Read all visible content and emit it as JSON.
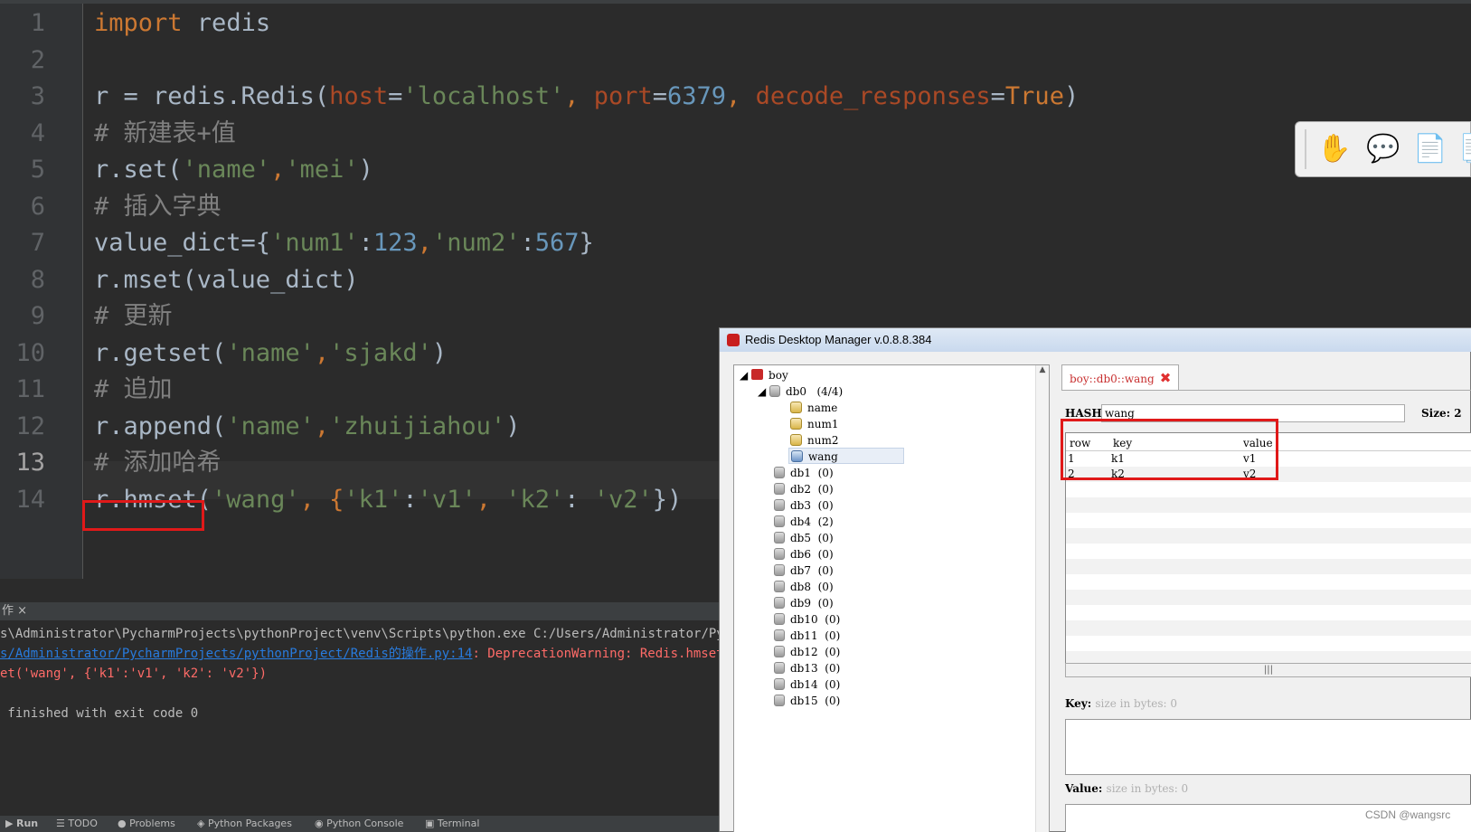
{
  "editor": {
    "line_numbers": [
      "1",
      "2",
      "3",
      "4",
      "5",
      "6",
      "7",
      "8",
      "9",
      "10",
      "11",
      "12",
      "13",
      "14"
    ],
    "lines": [
      {
        "a": "import",
        "b": " redis"
      },
      {},
      {
        "a": "r = redis.Redis(",
        "b": "host",
        "c": "=",
        "d": "'localhost'",
        "e": ", ",
        "f": "port",
        "g": "=",
        "h": "6379",
        "i": ", ",
        "j": "decode_responses",
        "k": "=",
        "l": "True",
        "m": ")"
      },
      {
        "a": "# 新建表+值"
      },
      {
        "a": "r.set(",
        "b": "'name'",
        "c": ",",
        "d": "'mei'",
        "e": ")"
      },
      {
        "a": "# 插入字典"
      },
      {
        "a": "value_dict={",
        "b": "'num1'",
        "c": ":",
        "d": "123",
        "e": ",",
        "f": "'num2'",
        "g": ":",
        "h": "567",
        "i": "}"
      },
      {
        "a": "r.mset(value_dict)"
      },
      {
        "a": "# 更新"
      },
      {
        "a": "r.getset(",
        "b": "'name'",
        "c": ",",
        "d": "'sjakd'",
        "e": ")"
      },
      {
        "a": "# 追加"
      },
      {
        "a": "r.append(",
        "b": "'name'",
        "c": ",",
        "d": "'zhuijiahou'",
        "e": ")"
      },
      {
        "a": "# 添加哈希"
      },
      {
        "a": "r.hmset(",
        "b": "'wang'",
        "c": ", {",
        "d": "'k1'",
        "e": ":",
        "f": "'v1'",
        "g": ", ",
        "h": "'k2'",
        "i": ": ",
        "j": "'v2'",
        "k": "})"
      }
    ]
  },
  "run": {
    "tab_label": "作 ×",
    "lines": [
      "s\\Administrator\\PycharmProjects\\pythonProject\\venv\\Scripts\\python.exe C:/Users/Administrator/Pycharm",
      "s/Administrator/PycharmProjects/pythonProject/Redis的操作.py:14",
      ": DeprecationWarning: Redis.hmset() is",
      "et('wang', {'k1':'v1', 'k2': 'v2'})",
      " finished with exit code 0"
    ]
  },
  "bottom_tabs": [
    "Run",
    "TODO",
    "Problems",
    "Python Packages",
    "Python Console",
    "Terminal"
  ],
  "rdm": {
    "title": "Redis Desktop Manager v.0.8.8.384",
    "tree": {
      "server": "boy",
      "db0": "db0   (4/4)",
      "keys": [
        "name",
        "num1",
        "num2",
        "wang"
      ],
      "dbs": [
        "db1  (0)",
        "db2  (0)",
        "db3  (0)",
        "db4  (2)",
        "db5  (0)",
        "db6  (0)",
        "db7  (0)",
        "db8  (0)",
        "db9  (0)",
        "db10  (0)",
        "db11  (0)",
        "db12  (0)",
        "db13  (0)",
        "db14  (0)",
        "db15  (0)"
      ]
    },
    "tab_label": "boy::db0::wang",
    "hash_label": "HASH:",
    "hash_value": "wang",
    "size_label": "Size: 2",
    "columns": [
      "row",
      "key",
      "value"
    ],
    "rows": [
      {
        "row": "1",
        "key": "k1",
        "value": "v1"
      },
      {
        "row": "2",
        "key": "k2",
        "value": "v2"
      }
    ],
    "key_label": "Key:",
    "key_hint": "size in bytes: 0",
    "value_label": "Value:",
    "value_hint": "size in bytes: 0"
  },
  "watermark": "CSDN @wangsrc",
  "colors": {
    "keyword": "#cc7832",
    "string": "#6a8759",
    "number": "#6897bb",
    "comment": "#808080",
    "param": "#aa4926",
    "highlight": "#e01919"
  }
}
